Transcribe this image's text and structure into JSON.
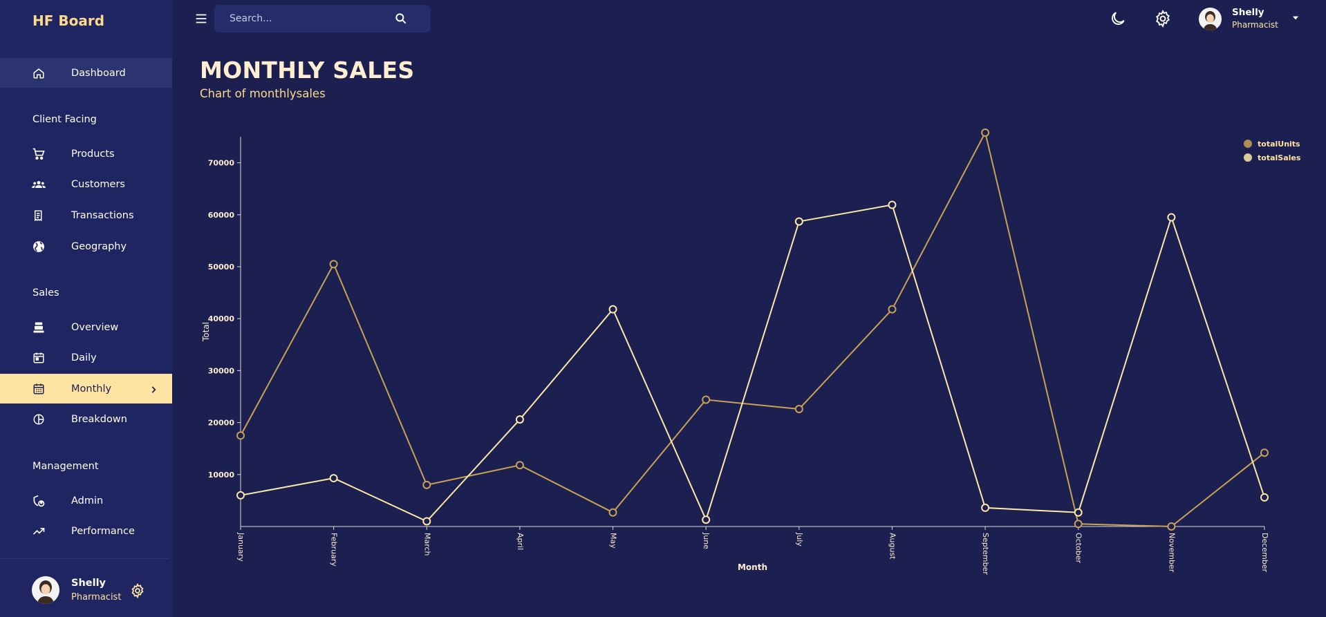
{
  "app": {
    "brand": "HF Board"
  },
  "topbar": {
    "search_placeholder": "Search...",
    "user": {
      "name": "Shelly",
      "role": "Pharmacist"
    }
  },
  "sidebar": {
    "items": [
      {
        "label": "Dashboard",
        "icon": "home-icon"
      },
      {
        "section": "Client Facing"
      },
      {
        "label": "Products",
        "icon": "shopping-cart-icon"
      },
      {
        "label": "Customers",
        "icon": "groups-icon"
      },
      {
        "label": "Transactions",
        "icon": "receipt-icon"
      },
      {
        "label": "Geography",
        "icon": "globe-icon"
      },
      {
        "section": "Sales"
      },
      {
        "label": "Overview",
        "icon": "point-of-sale-icon"
      },
      {
        "label": "Daily",
        "icon": "today-calendar-icon"
      },
      {
        "label": "Monthly",
        "icon": "calendar-month-icon",
        "active": true
      },
      {
        "label": "Breakdown",
        "icon": "pie-chart-icon"
      },
      {
        "section": "Management"
      },
      {
        "label": "Admin",
        "icon": "admin-shield-icon"
      },
      {
        "label": "Performance",
        "icon": "trending-up-icon"
      }
    ],
    "user": {
      "name": "Shelly",
      "role": "Pharmacist"
    }
  },
  "page": {
    "title": "MONTHLY SALES",
    "subtitle": "Chart of monthlysales"
  },
  "colors": {
    "background": "#1b2050",
    "sidebar": "#1f2561",
    "accent": "#ffe3a3",
    "totalSales_line": "#ffe9a6",
    "totalUnits_line": "#c9a254"
  },
  "chart_data": {
    "type": "line",
    "xlabel": "Month",
    "ylabel": "Total",
    "categories": [
      "January",
      "February",
      "March",
      "April",
      "May",
      "June",
      "July",
      "August",
      "September",
      "October",
      "November",
      "December"
    ],
    "ylim": [
      0,
      75000
    ],
    "yticks": [
      10000,
      20000,
      30000,
      40000,
      50000,
      60000,
      70000
    ],
    "grid": false,
    "legend_position": "top-right",
    "series": [
      {
        "name": "totalUnits",
        "color": "#c9a254",
        "values": [
          17500,
          50500,
          8000,
          11800,
          2700,
          24400,
          22600,
          41800,
          75800,
          500,
          0,
          14200
        ]
      },
      {
        "name": "totalSales",
        "color": "#ffe9a6",
        "values": [
          6000,
          9300,
          1000,
          20600,
          41800,
          1300,
          58700,
          61900,
          3600,
          2700,
          59500,
          5600
        ]
      }
    ]
  }
}
